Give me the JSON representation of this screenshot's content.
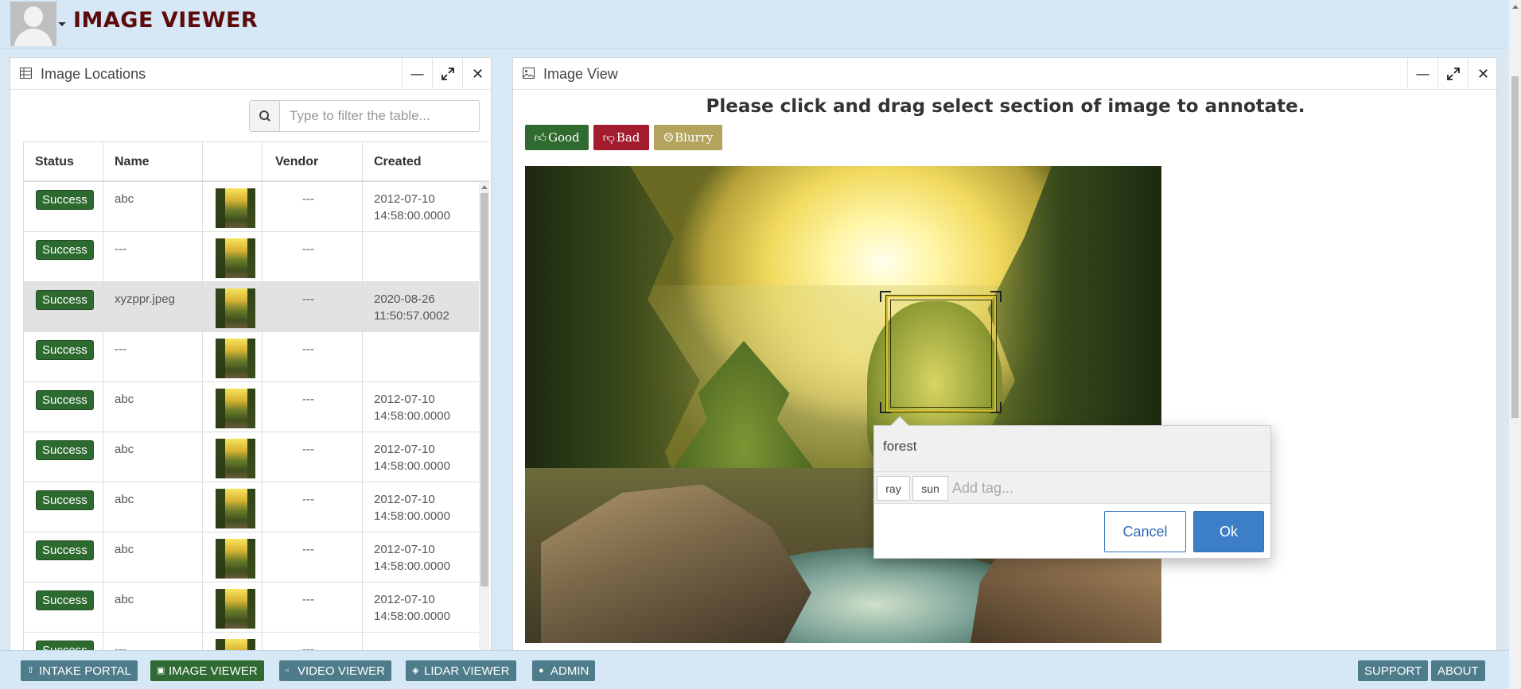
{
  "header": {
    "title": "IMAGE VIEWER",
    "avatar_icon": "user-avatar-icon"
  },
  "locations_panel": {
    "title": "Image Locations",
    "filter_placeholder": "Type to filter the table...",
    "columns": [
      "Status",
      "Name",
      "",
      "Vendor",
      "Created"
    ],
    "rows": [
      {
        "status": "Success",
        "name": "abc",
        "vendor": "---",
        "created_line1": "2012-07-10",
        "created_line2": "14:58:00.0000",
        "selected": false
      },
      {
        "status": "Success",
        "name": "---",
        "vendor": "---",
        "created_line1": "",
        "created_line2": "",
        "selected": false
      },
      {
        "status": "Success",
        "name": "xyzppr.jpeg",
        "vendor": "---",
        "created_line1": "2020-08-26",
        "created_line2": "11:50:57.0002",
        "selected": true
      },
      {
        "status": "Success",
        "name": "---",
        "vendor": "---",
        "created_line1": "",
        "created_line2": "",
        "selected": false
      },
      {
        "status": "Success",
        "name": "abc",
        "vendor": "---",
        "created_line1": "2012-07-10",
        "created_line2": "14:58:00.0000",
        "selected": false
      },
      {
        "status": "Success",
        "name": "abc",
        "vendor": "---",
        "created_line1": "2012-07-10",
        "created_line2": "14:58:00.0000",
        "selected": false
      },
      {
        "status": "Success",
        "name": "abc",
        "vendor": "---",
        "created_line1": "2012-07-10",
        "created_line2": "14:58:00.0000",
        "selected": false
      },
      {
        "status": "Success",
        "name": "abc",
        "vendor": "---",
        "created_line1": "2012-07-10",
        "created_line2": "14:58:00.0000",
        "selected": false
      },
      {
        "status": "Success",
        "name": "abc",
        "vendor": "---",
        "created_line1": "2012-07-10",
        "created_line2": "14:58:00.0000",
        "selected": false
      },
      {
        "status": "Success",
        "name": "---",
        "vendor": "---",
        "created_line1": "",
        "created_line2": "",
        "selected": false
      }
    ],
    "status_color": "#2d6a30"
  },
  "view_panel": {
    "title": "Image View",
    "instruction": "Please click and drag select section of image to annotate.",
    "quality_buttons": {
      "good": "Good",
      "bad": "Bad",
      "blurry": "Blurry"
    },
    "colors": {
      "good": "#2f6b2f",
      "bad": "#a31c2d",
      "blurry": "#b3a35c"
    }
  },
  "annotation_popup": {
    "comment": "forest",
    "tags": [
      "ray",
      "sun"
    ],
    "add_tag_placeholder": "Add tag...",
    "cancel_label": "Cancel",
    "ok_label": "Ok",
    "ok_color": "#3c7fc6"
  },
  "footer": {
    "nav": [
      "INTAKE PORTAL",
      "IMAGE VIEWER",
      "VIDEO VIEWER",
      "LIDAR VIEWER",
      "ADMIN"
    ],
    "active": "IMAGE VIEWER",
    "right": [
      "SUPPORT",
      "ABOUT"
    ]
  }
}
